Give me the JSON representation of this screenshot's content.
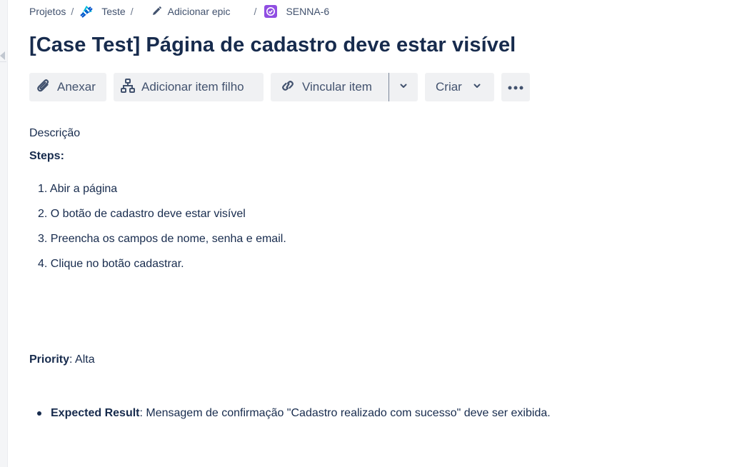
{
  "breadcrumb": {
    "projects": "Projetos",
    "separator": "/",
    "project": "Teste",
    "epic": "Adicionar epic",
    "issue_key": "SENNA-6"
  },
  "title": "[Case Test] Página de cadastro deve estar visível",
  "toolbar": {
    "attach": "Anexar",
    "add_child": "Adicionar item filho",
    "link_item": "Vincular item",
    "create": "Criar"
  },
  "description": {
    "label": "Descrição",
    "steps_label": "Steps:",
    "steps": [
      "1. Abir a página",
      "2. O botão de cadastro deve estar visível",
      "3. Preencha os campos de nome, senha e email.",
      "4. Clique no botão cadastrar."
    ],
    "priority_label": "Priority",
    "priority_value": ": Alta",
    "expected_label": "Expected Result",
    "expected_value": ": Mensagem de confirmação \"Cadastro realizado com sucesso\" deve ser exibida."
  },
  "colors": {
    "text": "#172b4d",
    "subtle_text": "#42526e",
    "button_bg": "#f0f1f3",
    "issue_icon": "#904ee2",
    "project_icon": "#0052cc"
  },
  "icons": {
    "project": "project-avatar-icon",
    "epic": "pencil-icon",
    "issue": "subtask-check-icon",
    "attach": "paperclip-icon",
    "child": "hierarchy-icon",
    "link": "link-icon",
    "dropdown": "chevron-down-icon",
    "more": "more-icon"
  }
}
